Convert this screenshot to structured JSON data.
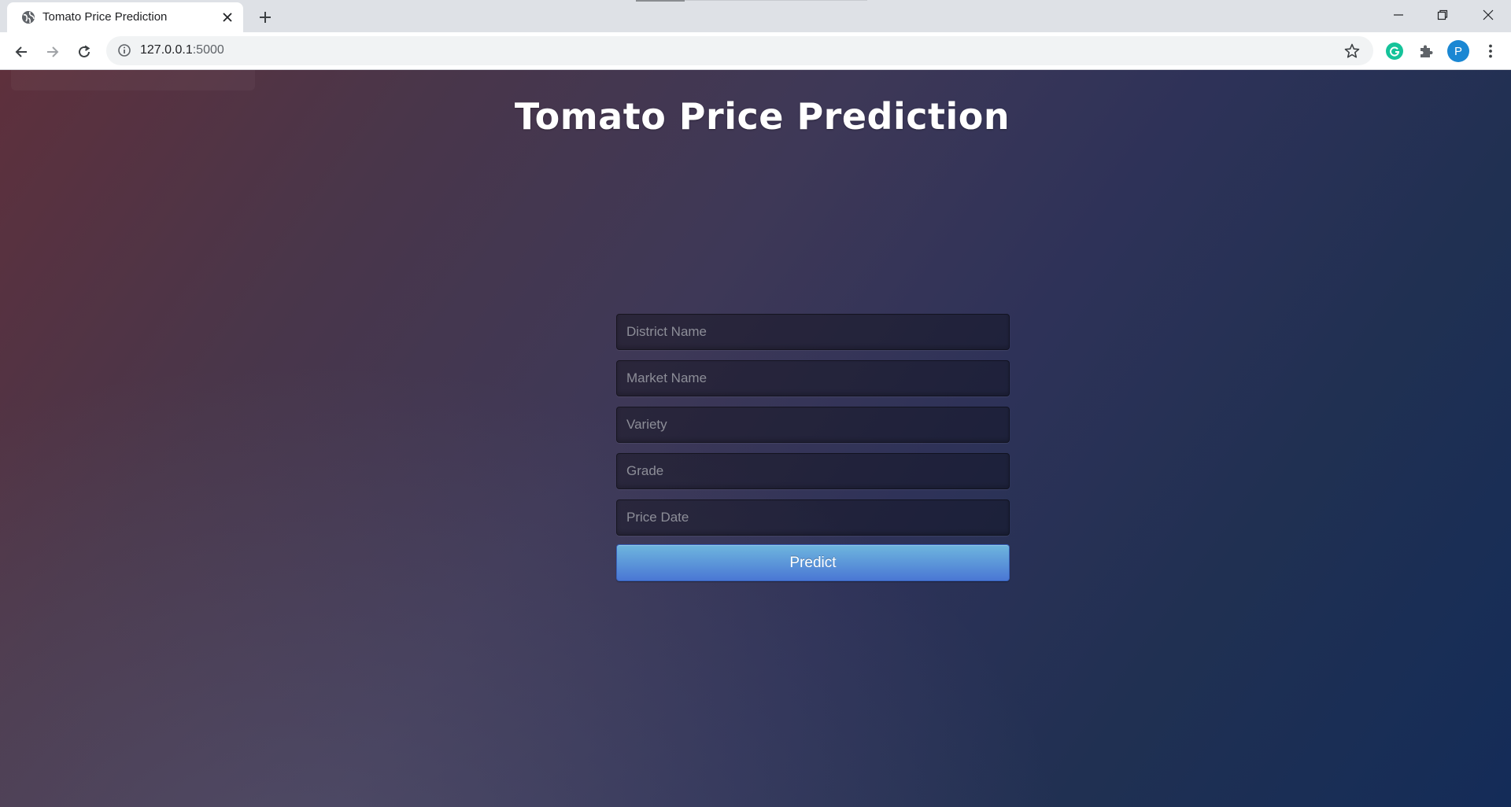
{
  "browser": {
    "tab": {
      "title": "Tomato Price Prediction",
      "favicon": "globe-icon",
      "close_icon": "close-icon"
    },
    "new_tab_icon": "plus-icon",
    "window_controls": [
      "minimize-icon",
      "restore-icon",
      "close-icon"
    ],
    "address_bar": {
      "host": "127.0.0.1",
      "port": ":5000",
      "info_icon": "info-icon",
      "bookmark_icon": "star-icon"
    },
    "extensions": {
      "grammarly_letter": "G",
      "puzzle_icon": "puzzle-icon",
      "profile_initial": "P",
      "menu_icon": "kebab-menu-icon"
    }
  },
  "page": {
    "title": "Tomato Price Prediction",
    "form": {
      "fields": [
        {
          "placeholder": "District Name"
        },
        {
          "placeholder": "Market Name"
        },
        {
          "placeholder": "Variety"
        },
        {
          "placeholder": "Grade"
        },
        {
          "placeholder": "Price Date"
        }
      ],
      "submit_label": "Predict"
    }
  },
  "colors": {
    "accent_button_top": "#6eb6de",
    "accent_button_bottom": "#4a77d4",
    "background_left": "#5e303c",
    "background_right": "#142c58",
    "grammarly": "#15c39a",
    "profile": "#1a87d3"
  }
}
